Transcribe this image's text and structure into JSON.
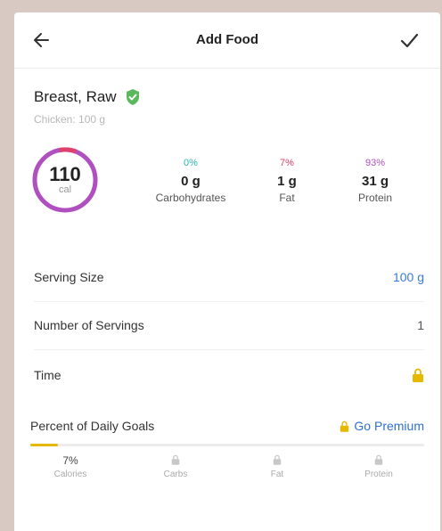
{
  "header": {
    "title": "Add Food",
    "back_icon": "arrow-left-icon",
    "confirm_icon": "checkmark-icon"
  },
  "food": {
    "name": "Breast, Raw",
    "subtitle": "Chicken: 100 g",
    "verified_icon": "verified-check-icon"
  },
  "calories": {
    "value": "110",
    "unit": "cal"
  },
  "macros": [
    {
      "percent": "0%",
      "grams": "0 g",
      "label": "Carbohydrates",
      "color": "#2bb5b5"
    },
    {
      "percent": "7%",
      "grams": "1 g",
      "label": "Fat",
      "color": "#e0406a"
    },
    {
      "percent": "93%",
      "grams": "31 g",
      "label": "Protein",
      "color": "#b04fc0"
    }
  ],
  "rows": {
    "serving_size": {
      "label": "Serving Size",
      "value": "100 g"
    },
    "servings": {
      "label": "Number of Servings",
      "value": "1"
    },
    "time": {
      "label": "Time",
      "icon": "lock-icon"
    }
  },
  "goals": {
    "label": "Percent of Daily Goals",
    "premium_label": "Go Premium",
    "progress_fraction": 0.07,
    "items": [
      {
        "value": "7%",
        "label": "Calories"
      },
      {
        "label": "Carbs",
        "icon": "lock-icon"
      },
      {
        "label": "Fat",
        "icon": "lock-icon"
      },
      {
        "label": "Protein",
        "icon": "lock-icon"
      }
    ]
  },
  "colors": {
    "accent_blue": "#3a7bd5",
    "premium_gold": "#e6b800",
    "ring_main": "#b04fc0",
    "ring_fat": "#e0406a"
  }
}
